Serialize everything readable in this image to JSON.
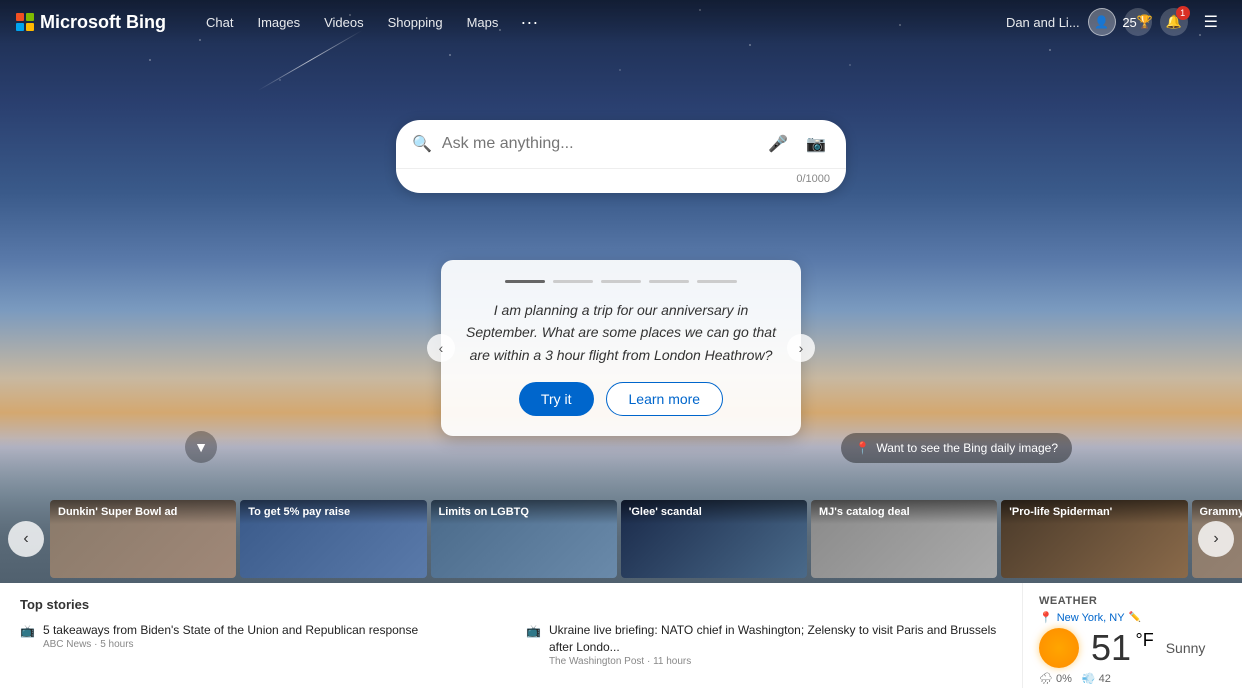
{
  "app": {
    "title": "Microsoft Bing"
  },
  "navbar": {
    "logo_text": "Bing",
    "links": [
      {
        "label": "Chat",
        "id": "chat"
      },
      {
        "label": "Images",
        "id": "images"
      },
      {
        "label": "Videos",
        "id": "videos"
      },
      {
        "label": "Shopping",
        "id": "shopping"
      },
      {
        "label": "Maps",
        "id": "maps"
      }
    ],
    "more_label": "···",
    "user_name": "Dan and Li...",
    "score": "25",
    "notification_count": "1"
  },
  "search": {
    "placeholder": "Ask me anything...",
    "char_count": "0/1000"
  },
  "suggestion_card": {
    "text": "I am planning a trip for our anniversary in September. What are some places we can go that are within a 3 hour flight from London Heathrow?",
    "try_label": "Try it",
    "learn_label": "Learn more",
    "dots": [
      {
        "active": true
      },
      {
        "active": false
      },
      {
        "active": false
      },
      {
        "active": false
      },
      {
        "active": false
      }
    ]
  },
  "daily_image": {
    "label": "Want to see the Bing daily image?"
  },
  "news_carousel": {
    "items": [
      {
        "label": "Dunkin' Super Bowl ad",
        "thumb_class": "news-thumb-1"
      },
      {
        "label": "To get 5% pay raise",
        "thumb_class": "news-thumb-2"
      },
      {
        "label": "Limits on LGBTQ",
        "thumb_class": "news-thumb-3"
      },
      {
        "label": "'Glee' scandal",
        "thumb_class": "news-thumb-4"
      },
      {
        "label": "MJ's catalog deal",
        "thumb_class": "news-thumb-5"
      },
      {
        "label": "'Pro-life Spiderman'",
        "thumb_class": "news-thumb-6"
      },
      {
        "label": "Grammys h...",
        "thumb_class": "news-thumb-1"
      }
    ]
  },
  "bottom": {
    "news_title": "Top stories",
    "news_items": [
      {
        "headline": "5 takeaways from Biden's State of the Union and Republican response",
        "source": "ABC News",
        "time": "5 hours",
        "icon": "📺"
      },
      {
        "headline": "Ukraine live briefing: NATO chief in Washington; Zelensky to visit Paris and Brussels after Londo...",
        "source": "The Washington Post",
        "time": "11 hours",
        "icon": "📺"
      }
    ]
  },
  "weather": {
    "title": "WEATHER",
    "location": "New York, NY",
    "temp": "51",
    "unit": "°F",
    "condition": "Sunny",
    "precip": "0%",
    "wind": "42"
  }
}
